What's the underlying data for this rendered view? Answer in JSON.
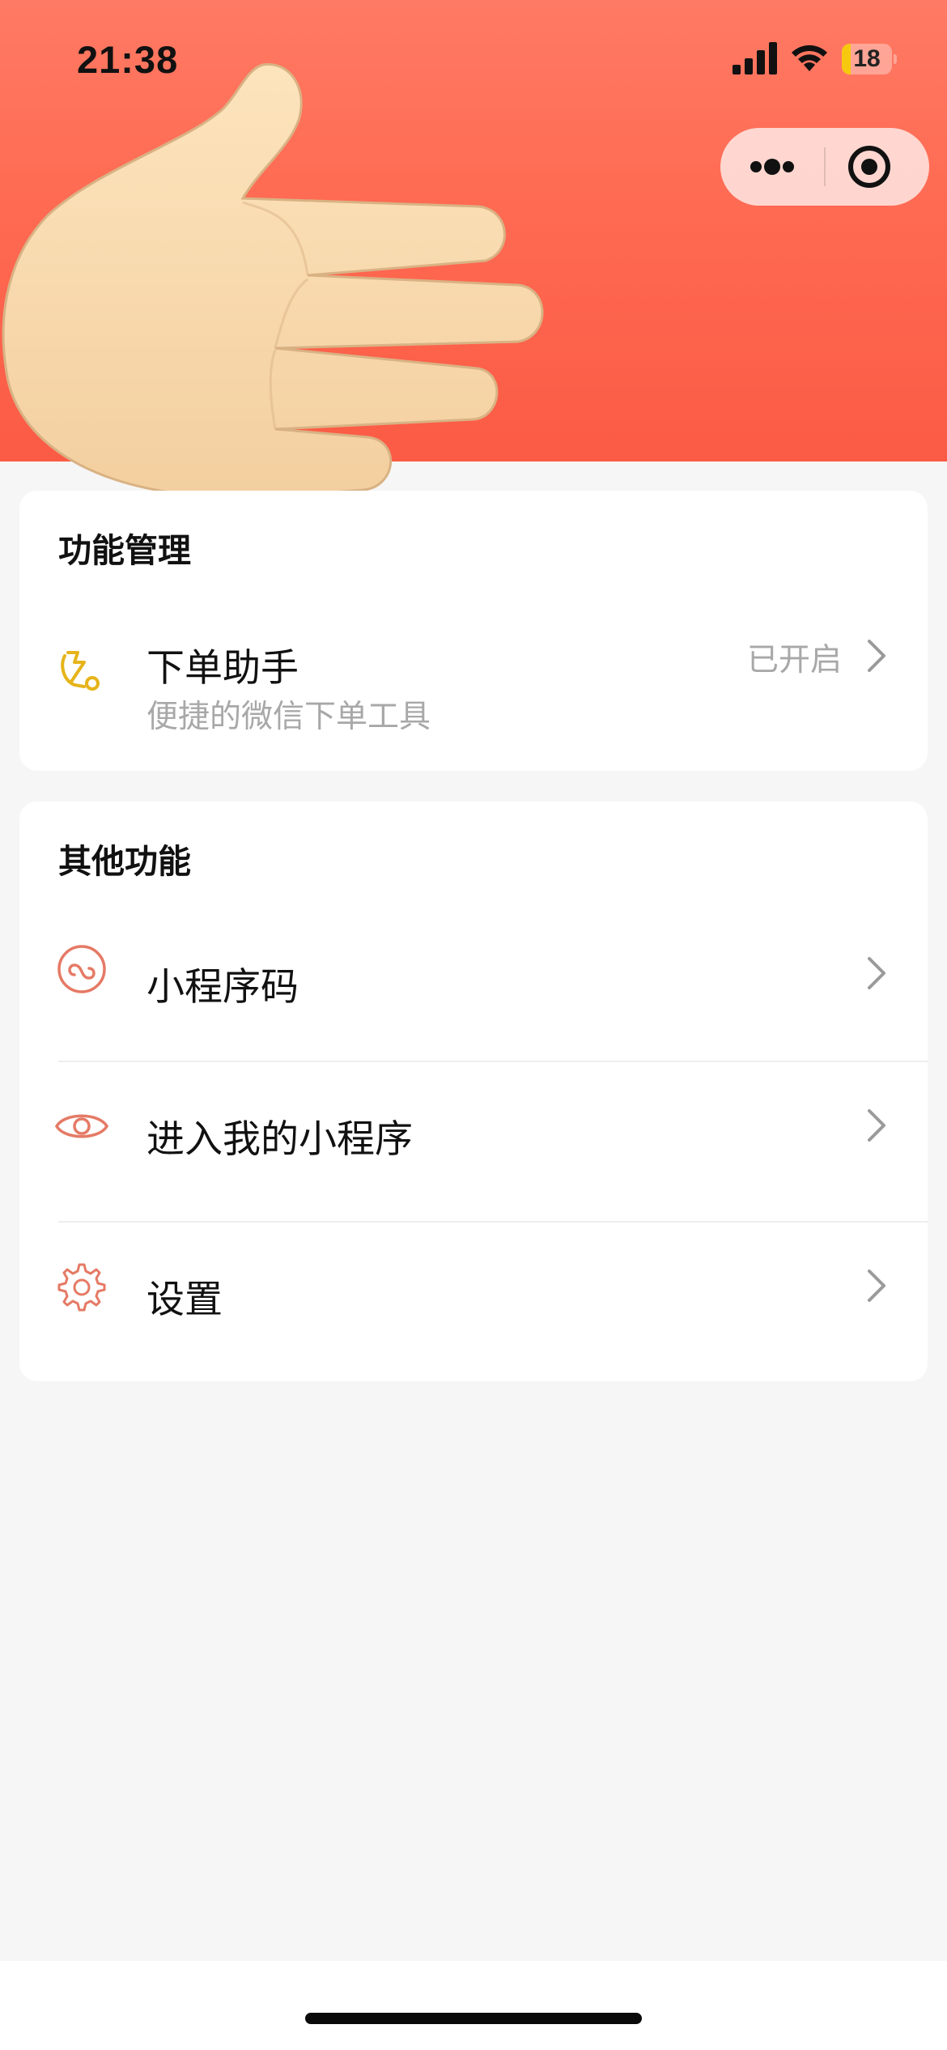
{
  "status_bar": {
    "time": "21:38",
    "battery_level": "18"
  },
  "function_management": {
    "title": "功能管理",
    "items": [
      {
        "title": "下单助手",
        "subtitle": "便捷的微信下单工具",
        "status": "已开启",
        "icon": "order-assistant-icon"
      }
    ]
  },
  "other_functions": {
    "title": "其他功能",
    "items": [
      {
        "title": "小程序码",
        "icon": "mini-program-code-icon"
      },
      {
        "title": "进入我的小程序",
        "icon": "eye-icon"
      },
      {
        "title": "设置",
        "icon": "gear-icon"
      }
    ]
  },
  "colors": {
    "header_gradient_top": "#ff7a64",
    "header_gradient_bottom": "#fb5b45",
    "accent_icon": "#e57a65",
    "order_icon": "#e6b41a"
  }
}
